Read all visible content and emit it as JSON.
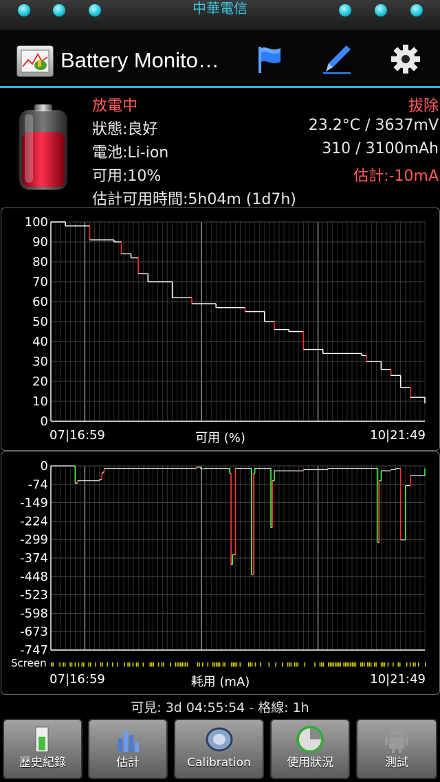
{
  "status_bar": {
    "carrier": "中華電信"
  },
  "action_bar": {
    "title": "Battery Monito…",
    "icons": [
      "flag-icon",
      "pencil-icon",
      "gear-icon"
    ]
  },
  "battery": {
    "state": "放電中",
    "plug": "拔除",
    "health": "狀態:良好",
    "temp_voltage": "23.2°C / 3637mV",
    "type": "電池:Li-ion",
    "capacity": "310 / 3100mAh",
    "available": "可用:10%",
    "estimate": "估計:-10mA",
    "time_left": "估計可用時間:5h04m (1d7h)"
  },
  "chart_data": [
    {
      "type": "line",
      "title": "",
      "xlabel": "可用 (%)",
      "x_start_label": "07|16:59",
      "x_end_label": "10|21:49",
      "ylim": [
        0,
        100
      ],
      "y_ticks": [
        "100",
        "90",
        "80",
        "70",
        "60",
        "50",
        "40",
        "30",
        "20",
        "10",
        "0"
      ],
      "x_range_hours": [
        0,
        77
      ],
      "series": [
        {
          "values_x_hours": [
            0,
            3,
            8,
            13,
            14.5,
            16.5,
            18,
            20,
            22,
            25,
            29,
            34,
            40,
            44,
            46,
            49,
            52,
            56,
            59,
            64,
            65,
            68,
            70,
            72,
            74,
            77
          ],
          "values_y": [
            100,
            98,
            91,
            90,
            84,
            82,
            74,
            70,
            70,
            62,
            59,
            57,
            55,
            50,
            46,
            45,
            36,
            34,
            34,
            33,
            30,
            26,
            23,
            17,
            12,
            9
          ]
        }
      ]
    },
    {
      "type": "line",
      "title": "",
      "xlabel": "耗用 (mA)",
      "x_start_label": "07|16:59",
      "x_end_label": "10|21:49",
      "ylim": [
        -747,
        0
      ],
      "y_ticks": [
        "0",
        "-74",
        "-149",
        "-224",
        "-299",
        "-374",
        "-448",
        "-523",
        "-598",
        "-673",
        "-747"
      ],
      "screen_label": "Screen",
      "series": [
        {
          "values_x_hours": [
            0,
            4,
            5,
            5.5,
            10,
            10.5,
            10.7,
            11,
            13,
            14,
            15,
            16,
            17,
            19,
            20,
            30,
            30.8,
            31.6,
            32,
            33,
            36.8,
            37.1,
            37.4,
            38,
            40,
            41,
            41.3,
            41.7,
            42,
            45,
            45.3,
            45.6,
            46,
            52,
            57,
            58,
            59,
            60,
            62,
            67,
            67.3,
            67.6,
            68,
            70,
            71,
            72,
            73,
            74,
            77
          ],
          "values_y": [
            0,
            0,
            -70,
            -60,
            -55,
            -30,
            -25,
            -10,
            -10,
            -10,
            -10,
            -10,
            -10,
            -10,
            -10,
            -5,
            -12,
            -10,
            -10,
            -10,
            -30,
            -400,
            -360,
            -10,
            -10,
            -10,
            -440,
            -30,
            -10,
            -10,
            -250,
            -60,
            -20,
            -15,
            -10,
            -10,
            -10,
            -10,
            -10,
            -10,
            -310,
            -60,
            -20,
            -15,
            -10,
            -300,
            -80,
            -40,
            -10
          ]
        }
      ]
    }
  ],
  "footer": {
    "visible_range": "可見: 3d 04:55:54 - 格線: 1h"
  },
  "buttons": [
    {
      "label": "歷史紀錄",
      "icon": "history-icon"
    },
    {
      "label": "估計",
      "icon": "estimate-icon"
    },
    {
      "label": "Calibration",
      "icon": "calibration-icon"
    },
    {
      "label": "使用狀況",
      "icon": "usage-icon"
    },
    {
      "label": "測試",
      "icon": "android-icon"
    }
  ]
}
